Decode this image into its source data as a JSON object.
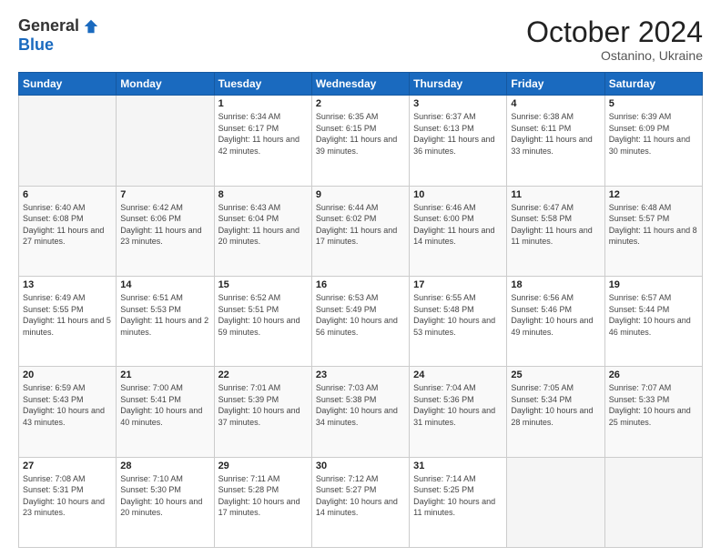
{
  "header": {
    "logo_general": "General",
    "logo_blue": "Blue",
    "month_title": "October 2024",
    "location": "Ostanino, Ukraine"
  },
  "days_of_week": [
    "Sunday",
    "Monday",
    "Tuesday",
    "Wednesday",
    "Thursday",
    "Friday",
    "Saturday"
  ],
  "weeks": [
    [
      {
        "day": "",
        "sunrise": "",
        "sunset": "",
        "daylight": "",
        "empty": true
      },
      {
        "day": "",
        "sunrise": "",
        "sunset": "",
        "daylight": "",
        "empty": true
      },
      {
        "day": "1",
        "sunrise": "Sunrise: 6:34 AM",
        "sunset": "Sunset: 6:17 PM",
        "daylight": "Daylight: 11 hours and 42 minutes.",
        "empty": false
      },
      {
        "day": "2",
        "sunrise": "Sunrise: 6:35 AM",
        "sunset": "Sunset: 6:15 PM",
        "daylight": "Daylight: 11 hours and 39 minutes.",
        "empty": false
      },
      {
        "day": "3",
        "sunrise": "Sunrise: 6:37 AM",
        "sunset": "Sunset: 6:13 PM",
        "daylight": "Daylight: 11 hours and 36 minutes.",
        "empty": false
      },
      {
        "day": "4",
        "sunrise": "Sunrise: 6:38 AM",
        "sunset": "Sunset: 6:11 PM",
        "daylight": "Daylight: 11 hours and 33 minutes.",
        "empty": false
      },
      {
        "day": "5",
        "sunrise": "Sunrise: 6:39 AM",
        "sunset": "Sunset: 6:09 PM",
        "daylight": "Daylight: 11 hours and 30 minutes.",
        "empty": false
      }
    ],
    [
      {
        "day": "6",
        "sunrise": "Sunrise: 6:40 AM",
        "sunset": "Sunset: 6:08 PM",
        "daylight": "Daylight: 11 hours and 27 minutes.",
        "empty": false
      },
      {
        "day": "7",
        "sunrise": "Sunrise: 6:42 AM",
        "sunset": "Sunset: 6:06 PM",
        "daylight": "Daylight: 11 hours and 23 minutes.",
        "empty": false
      },
      {
        "day": "8",
        "sunrise": "Sunrise: 6:43 AM",
        "sunset": "Sunset: 6:04 PM",
        "daylight": "Daylight: 11 hours and 20 minutes.",
        "empty": false
      },
      {
        "day": "9",
        "sunrise": "Sunrise: 6:44 AM",
        "sunset": "Sunset: 6:02 PM",
        "daylight": "Daylight: 11 hours and 17 minutes.",
        "empty": false
      },
      {
        "day": "10",
        "sunrise": "Sunrise: 6:46 AM",
        "sunset": "Sunset: 6:00 PM",
        "daylight": "Daylight: 11 hours and 14 minutes.",
        "empty": false
      },
      {
        "day": "11",
        "sunrise": "Sunrise: 6:47 AM",
        "sunset": "Sunset: 5:58 PM",
        "daylight": "Daylight: 11 hours and 11 minutes.",
        "empty": false
      },
      {
        "day": "12",
        "sunrise": "Sunrise: 6:48 AM",
        "sunset": "Sunset: 5:57 PM",
        "daylight": "Daylight: 11 hours and 8 minutes.",
        "empty": false
      }
    ],
    [
      {
        "day": "13",
        "sunrise": "Sunrise: 6:49 AM",
        "sunset": "Sunset: 5:55 PM",
        "daylight": "Daylight: 11 hours and 5 minutes.",
        "empty": false
      },
      {
        "day": "14",
        "sunrise": "Sunrise: 6:51 AM",
        "sunset": "Sunset: 5:53 PM",
        "daylight": "Daylight: 11 hours and 2 minutes.",
        "empty": false
      },
      {
        "day": "15",
        "sunrise": "Sunrise: 6:52 AM",
        "sunset": "Sunset: 5:51 PM",
        "daylight": "Daylight: 10 hours and 59 minutes.",
        "empty": false
      },
      {
        "day": "16",
        "sunrise": "Sunrise: 6:53 AM",
        "sunset": "Sunset: 5:49 PM",
        "daylight": "Daylight: 10 hours and 56 minutes.",
        "empty": false
      },
      {
        "day": "17",
        "sunrise": "Sunrise: 6:55 AM",
        "sunset": "Sunset: 5:48 PM",
        "daylight": "Daylight: 10 hours and 53 minutes.",
        "empty": false
      },
      {
        "day": "18",
        "sunrise": "Sunrise: 6:56 AM",
        "sunset": "Sunset: 5:46 PM",
        "daylight": "Daylight: 10 hours and 49 minutes.",
        "empty": false
      },
      {
        "day": "19",
        "sunrise": "Sunrise: 6:57 AM",
        "sunset": "Sunset: 5:44 PM",
        "daylight": "Daylight: 10 hours and 46 minutes.",
        "empty": false
      }
    ],
    [
      {
        "day": "20",
        "sunrise": "Sunrise: 6:59 AM",
        "sunset": "Sunset: 5:43 PM",
        "daylight": "Daylight: 10 hours and 43 minutes.",
        "empty": false
      },
      {
        "day": "21",
        "sunrise": "Sunrise: 7:00 AM",
        "sunset": "Sunset: 5:41 PM",
        "daylight": "Daylight: 10 hours and 40 minutes.",
        "empty": false
      },
      {
        "day": "22",
        "sunrise": "Sunrise: 7:01 AM",
        "sunset": "Sunset: 5:39 PM",
        "daylight": "Daylight: 10 hours and 37 minutes.",
        "empty": false
      },
      {
        "day": "23",
        "sunrise": "Sunrise: 7:03 AM",
        "sunset": "Sunset: 5:38 PM",
        "daylight": "Daylight: 10 hours and 34 minutes.",
        "empty": false
      },
      {
        "day": "24",
        "sunrise": "Sunrise: 7:04 AM",
        "sunset": "Sunset: 5:36 PM",
        "daylight": "Daylight: 10 hours and 31 minutes.",
        "empty": false
      },
      {
        "day": "25",
        "sunrise": "Sunrise: 7:05 AM",
        "sunset": "Sunset: 5:34 PM",
        "daylight": "Daylight: 10 hours and 28 minutes.",
        "empty": false
      },
      {
        "day": "26",
        "sunrise": "Sunrise: 7:07 AM",
        "sunset": "Sunset: 5:33 PM",
        "daylight": "Daylight: 10 hours and 25 minutes.",
        "empty": false
      }
    ],
    [
      {
        "day": "27",
        "sunrise": "Sunrise: 7:08 AM",
        "sunset": "Sunset: 5:31 PM",
        "daylight": "Daylight: 10 hours and 23 minutes.",
        "empty": false
      },
      {
        "day": "28",
        "sunrise": "Sunrise: 7:10 AM",
        "sunset": "Sunset: 5:30 PM",
        "daylight": "Daylight: 10 hours and 20 minutes.",
        "empty": false
      },
      {
        "day": "29",
        "sunrise": "Sunrise: 7:11 AM",
        "sunset": "Sunset: 5:28 PM",
        "daylight": "Daylight: 10 hours and 17 minutes.",
        "empty": false
      },
      {
        "day": "30",
        "sunrise": "Sunrise: 7:12 AM",
        "sunset": "Sunset: 5:27 PM",
        "daylight": "Daylight: 10 hours and 14 minutes.",
        "empty": false
      },
      {
        "day": "31",
        "sunrise": "Sunrise: 7:14 AM",
        "sunset": "Sunset: 5:25 PM",
        "daylight": "Daylight: 10 hours and 11 minutes.",
        "empty": false
      },
      {
        "day": "",
        "sunrise": "",
        "sunset": "",
        "daylight": "",
        "empty": true
      },
      {
        "day": "",
        "sunrise": "",
        "sunset": "",
        "daylight": "",
        "empty": true
      }
    ]
  ]
}
